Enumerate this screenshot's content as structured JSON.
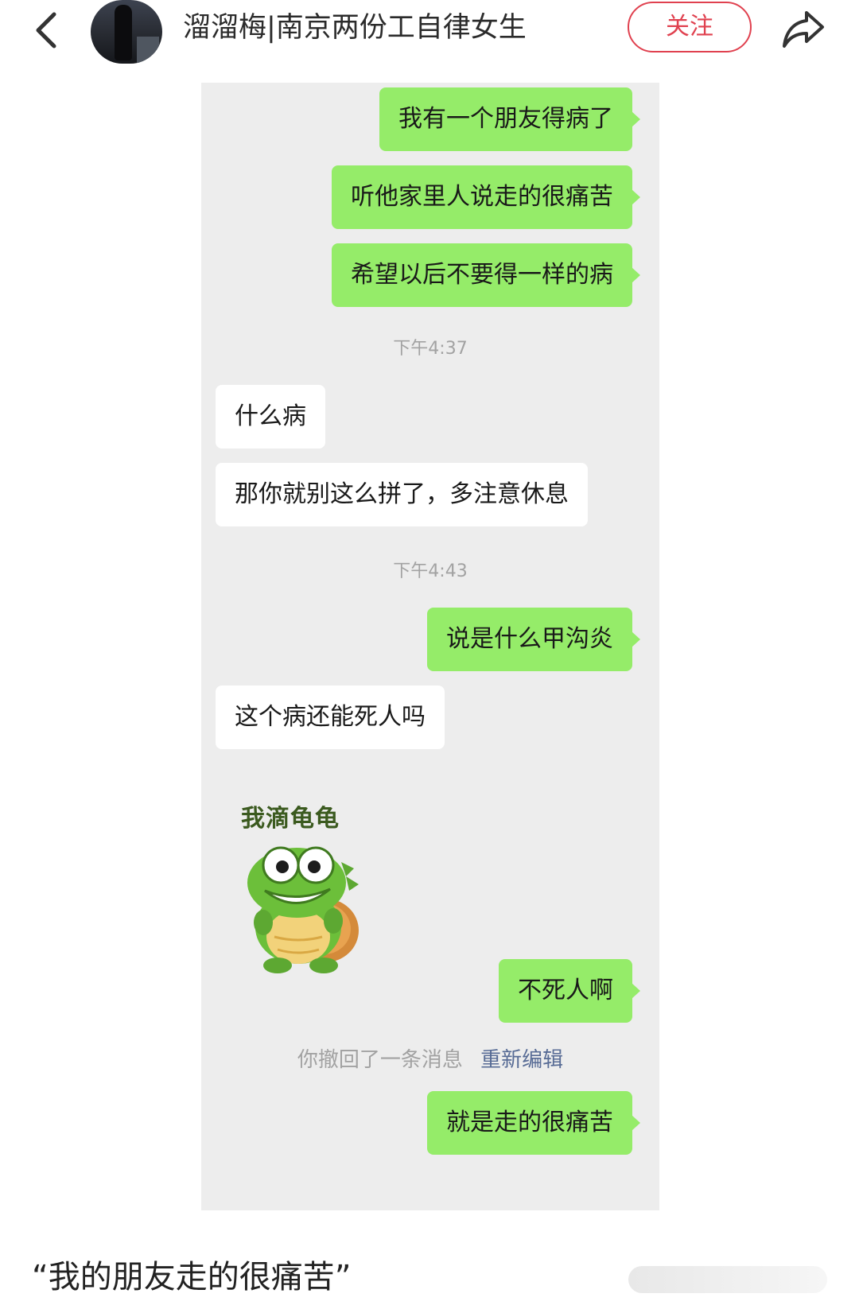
{
  "header": {
    "author_name": "溜溜梅|南京两份工自律女生",
    "follow_label": "关注"
  },
  "chat": {
    "msg1": "我有一个朋友得病了",
    "msg2": "听他家里人说走的很痛苦",
    "msg3": "希望以后不要得一样的病",
    "time1": "下午4:37",
    "reply1": "什么病",
    "reply2": "那你就别这么拼了，多注意休息",
    "time2": "下午4:43",
    "msg4": "说是什么甲沟炎",
    "reply3": "这个病还能死人吗",
    "sticker_text": "我滴龟龟",
    "msg5": "不死人啊",
    "recall_text": "你撤回了一条消息",
    "recall_edit": "重新编辑",
    "msg6": "就是走的很痛苦"
  },
  "post": {
    "title": "“我的朋友走的很痛苦”"
  },
  "colors": {
    "accent": "#e0414f",
    "my_bubble": "#95ec69",
    "chat_bg": "#ededed",
    "link": "#576b95"
  },
  "icons": [
    "back-icon",
    "share-icon"
  ]
}
